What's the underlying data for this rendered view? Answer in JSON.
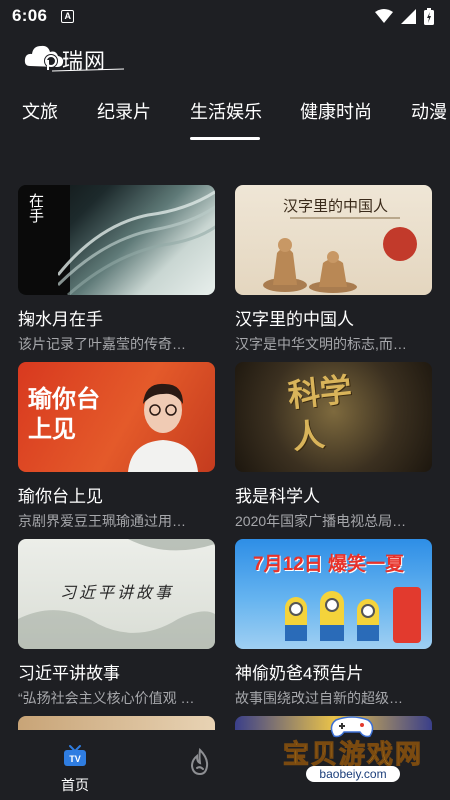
{
  "status_bar": {
    "time": "6:06",
    "notif_badge": "A"
  },
  "brand": {
    "logo_text": "瑞网"
  },
  "tabs": [
    {
      "label": "文旅"
    },
    {
      "label": "纪录片"
    },
    {
      "label": "生活娱乐",
      "active": true
    },
    {
      "label": "健康时尚"
    },
    {
      "label": "动漫"
    }
  ],
  "cards": [
    {
      "title": "掬水月在手",
      "desc": "该片记录了叶嘉莹的传奇…",
      "thumb_caption": "在手"
    },
    {
      "title": "汉字里的中国人",
      "desc": "汉字是中华文明的标志,而…",
      "thumb_caption": "汉字里的中国人"
    },
    {
      "title": "瑜你台上见",
      "desc": "京剧界爱豆王珮瑜通过用…",
      "thumb_caption": "瑜你台上见"
    },
    {
      "title": "我是科学人",
      "desc": "2020年国家广播电视总局…",
      "thumb_caption": "科学人"
    },
    {
      "title": "习近平讲故事",
      "desc": "“弘扬社会主义核心价值观 …",
      "thumb_caption": "习近平讲故事"
    },
    {
      "title": "神偷奶爸4预告片",
      "desc": "故事围绕改过自新的超级…",
      "thumb_caption": "7月12日 爆笑一夏"
    }
  ],
  "bottom_nav": {
    "home_label": "首页",
    "tv_badge": "TV"
  },
  "watermark": {
    "text": "宝贝游戏网",
    "url": "baobeiy.com"
  },
  "colors": {
    "background": "#1e1f23",
    "text_secondary": "#a6a7ab",
    "accent_blue": "#2f7de1"
  }
}
